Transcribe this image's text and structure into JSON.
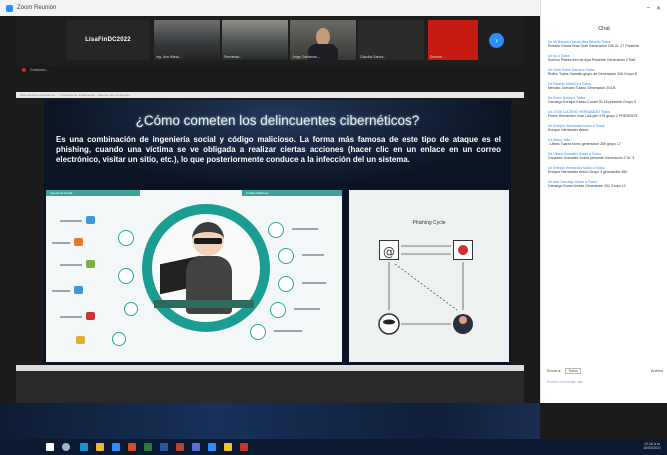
{
  "window": {
    "title": "Zoom Reunión"
  },
  "participants": [
    {
      "label": "LisaFinDC2022",
      "caption": ""
    },
    {
      "label": "",
      "caption": "Ing. Ana Maria..."
    },
    {
      "label": "",
      "caption": "Fernanda..."
    },
    {
      "label": "",
      "caption": "Jorge Cardenas..."
    },
    {
      "label": "",
      "caption": "Claudia Garcia..."
    },
    {
      "label": "",
      "caption": "Zulema..."
    }
  ],
  "strip_footer": "Grabando...",
  "share_bar_text": "Está viendo la pantalla de ... · Opciones de visualización · Detener uso compartido",
  "slide": {
    "title": "¿Cómo cometen los delincuentes cibernéticos?",
    "body": "Es una combinación de ingeniería social y código malicioso. La forma más famosa de este tipo de ataque es el phishing, cuando una víctima se ve obligada a realizar ciertas acciones (hacer clic en un enlace en un correo electrónico, visitar un sitio, etc.), lo que posteriormente conduce a la infección del un sistema.",
    "left_band_labels": [
      "Ingeniería Social",
      "Código Malicioso"
    ],
    "diagram_title": "Phishing Cycle"
  },
  "chat": {
    "title": "Chat",
    "messages": [
      {
        "from": "De Mi Rosario Garcia Mtra Briseño Todos",
        "text": "Rosario Garcia Brav Grail Generación 206 Gr. 27 Presente"
      },
      {
        "from": "De yo a Todos",
        "text": "Sumino Pilares tren de Ayla Presente Generación 2 Ra6"
      },
      {
        "from": "De Keila Todos Garcia a Todos",
        "text": "Rufino Todos Gamallo grupo de Generación 206 Grupo 8"
      },
      {
        "from": "De Ricardo MANGA a Todos",
        "text": "Mendez Jormaiin Tuiano Generación 204-B"
      },
      {
        "from": "De Erwin Dubbs a Todos",
        "text": "Camargo Enrique Keeso Curael 25-18 presente Grupo 3"
      },
      {
        "from": "De JOSE LUCERIO HERNANDEZ Todos",
        "text": "Flores Hernandez Jose Luis gen 278 grupo 2 PRESENTE"
      },
      {
        "from": "De Enrique Hernández todos a Todos",
        "text": "Enrique Hernández Arturo"
      },
      {
        "from": "De Arturo Tello",
        "text": "- Ulises Tuarez tuimo generación 269 grupo 17"
      },
      {
        "from": "De Ulises Gonzalez Grado a Todos",
        "text": "Gonzalez Gonzalez Juana presente Generación 2 Gr. 3"
      },
      {
        "from": "De Enrique Hernández todos a Todos",
        "text": "Enrique Hernández Arturo Grupo 4 generación 280"
      },
      {
        "from": "De Ana Camargo Duran a Todos",
        "text": "Camargo Duran Arreda Generación 202 Grupo 12"
      }
    ],
    "to_label": "Enviar a:",
    "to_value": "Todos",
    "file_label": "Archivo",
    "input_hint": "Escriba un mensaje aquí..."
  },
  "taskbar": {
    "time": "10:16 a.m.",
    "date": "18/03/2021"
  },
  "colors": {
    "zoom_blue": "#2d8cff",
    "teal": "#1c9d93",
    "record_red": "#d6281f"
  }
}
